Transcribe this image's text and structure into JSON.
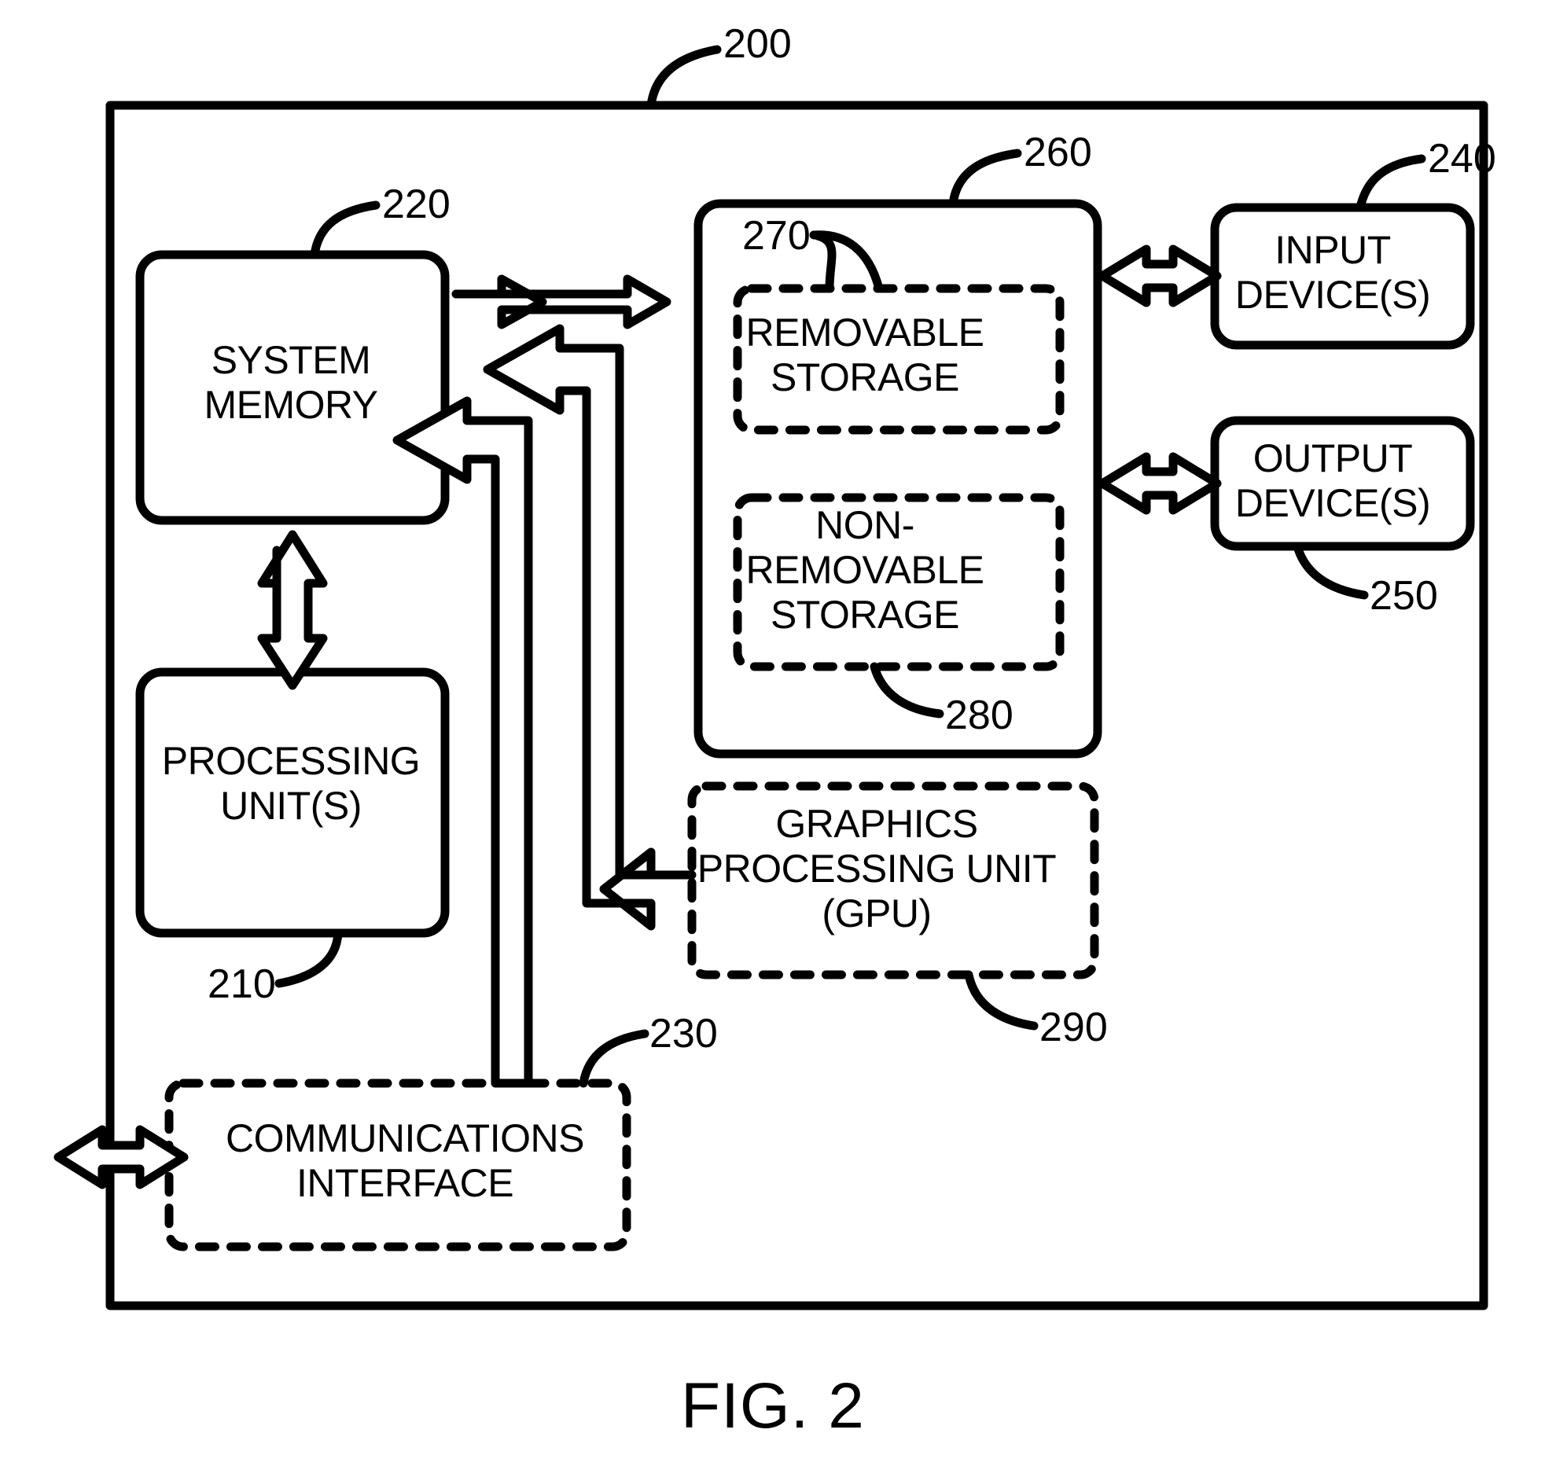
{
  "figure": {
    "caption": "FIG. 2",
    "system_ref": "200"
  },
  "blocks": {
    "system_memory": {
      "label": "SYSTEM\nMEMORY",
      "ref": "220",
      "border": "solid"
    },
    "processing_unit": {
      "label": "PROCESSING\nUNIT(S)",
      "ref": "210",
      "border": "solid"
    },
    "storage": {
      "label": "",
      "ref": "260",
      "border": "solid"
    },
    "removable_storage": {
      "label": "REMOVABLE\nSTORAGE",
      "ref": "270",
      "border": "dashed"
    },
    "non_removable_storage": {
      "label": "NON-\nREMOVABLE\nSTORAGE",
      "ref": "280",
      "border": "dashed"
    },
    "gpu": {
      "label": "GRAPHICS\nPROCESSING UNIT\n(GPU)",
      "ref": "290",
      "border": "dashed"
    },
    "communications": {
      "label": "COMMUNICATIONS\nINTERFACE",
      "ref": "230",
      "border": "dashed"
    },
    "input_devices": {
      "label": "INPUT\nDEVICE(S)",
      "ref": "240",
      "border": "solid"
    },
    "output_devices": {
      "label": "OUTPUT\nDEVICE(S)",
      "ref": "250",
      "border": "solid"
    }
  },
  "connections": [
    {
      "name": "system-memory-to-storage",
      "type": "double-headed",
      "orientation": "horizontal"
    },
    {
      "name": "system-memory-to-processing-unit",
      "type": "double-headed",
      "orientation": "vertical"
    },
    {
      "name": "storage-to-input-devices",
      "type": "double-headed",
      "orientation": "horizontal"
    },
    {
      "name": "storage-to-output-devices",
      "type": "double-headed",
      "orientation": "horizontal"
    },
    {
      "name": "gpu-to-system-memory",
      "type": "single-headed",
      "orientation": "elbow"
    },
    {
      "name": "communications-to-system-memory",
      "type": "single-headed",
      "orientation": "elbow"
    },
    {
      "name": "external-to-communications",
      "type": "double-headed",
      "orientation": "horizontal"
    }
  ],
  "colors": {
    "stroke": "#000000",
    "background": "#ffffff"
  }
}
